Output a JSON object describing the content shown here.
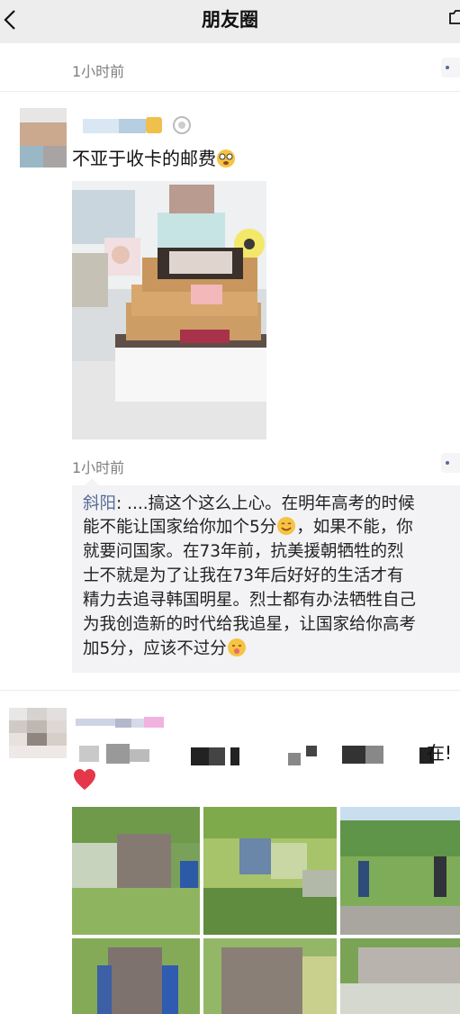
{
  "navbar": {
    "title": "朋友圈",
    "back_icon": "chevron-left-icon",
    "camera_icon": "camera-icon"
  },
  "prev_post": {
    "time": "1小时前"
  },
  "post1": {
    "text": "不亚于收卡的邮费",
    "text_emoji": "dizzy-face-emoji",
    "time": "1小时前",
    "comment": {
      "commenter": "斜阳",
      "separator": ": ",
      "lines": [
        "....搞这个这么上心。在明年高考的时候",
        "能不能让国家给你加个5分",
        "，如果不能，你",
        "就要问国家。在73年前，抗美援朝牺牲的烈",
        "士不就是为了让我在73年后好好的生活才有",
        "精力去追寻韩国明星。烈士都有办法牺牲自己",
        "为我创造新的时代给我追星，让国家给你高考",
        "加5分，应该不过分"
      ]
    }
  },
  "post2": {
    "text_end": "在!",
    "heart_icon": "red-heart-emoji"
  },
  "colors": {
    "nav_bg": "#ededed",
    "link_blue": "#576b95",
    "comment_bg": "#f3f3f5",
    "time_gray": "#7f7f7f"
  }
}
